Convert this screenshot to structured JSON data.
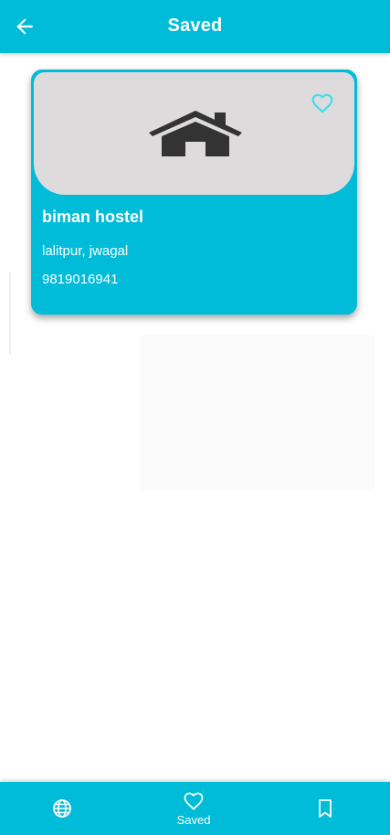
{
  "app_bar": {
    "title": "Saved",
    "back_icon": "arrow-left-icon"
  },
  "saved_items": [
    {
      "name": "biman hostel",
      "address": "lalitpur, jwagal",
      "phone": "9819016941",
      "image_icon": "house-icon",
      "favorite_icon": "heart-outline-icon",
      "favorited": true
    }
  ],
  "bottom_nav": {
    "items": [
      {
        "icon": "globe-icon",
        "label": ""
      },
      {
        "icon": "heart-outline-icon",
        "label": "Saved",
        "active": true
      },
      {
        "icon": "bookmark-outline-icon",
        "label": ""
      }
    ]
  },
  "colors": {
    "primary": "#00bcd8",
    "card_image_bg": "#dedbdc",
    "house_icon": "#333333",
    "favorite_heart": "#38e0f0",
    "text_on_primary": "#ffffff"
  }
}
